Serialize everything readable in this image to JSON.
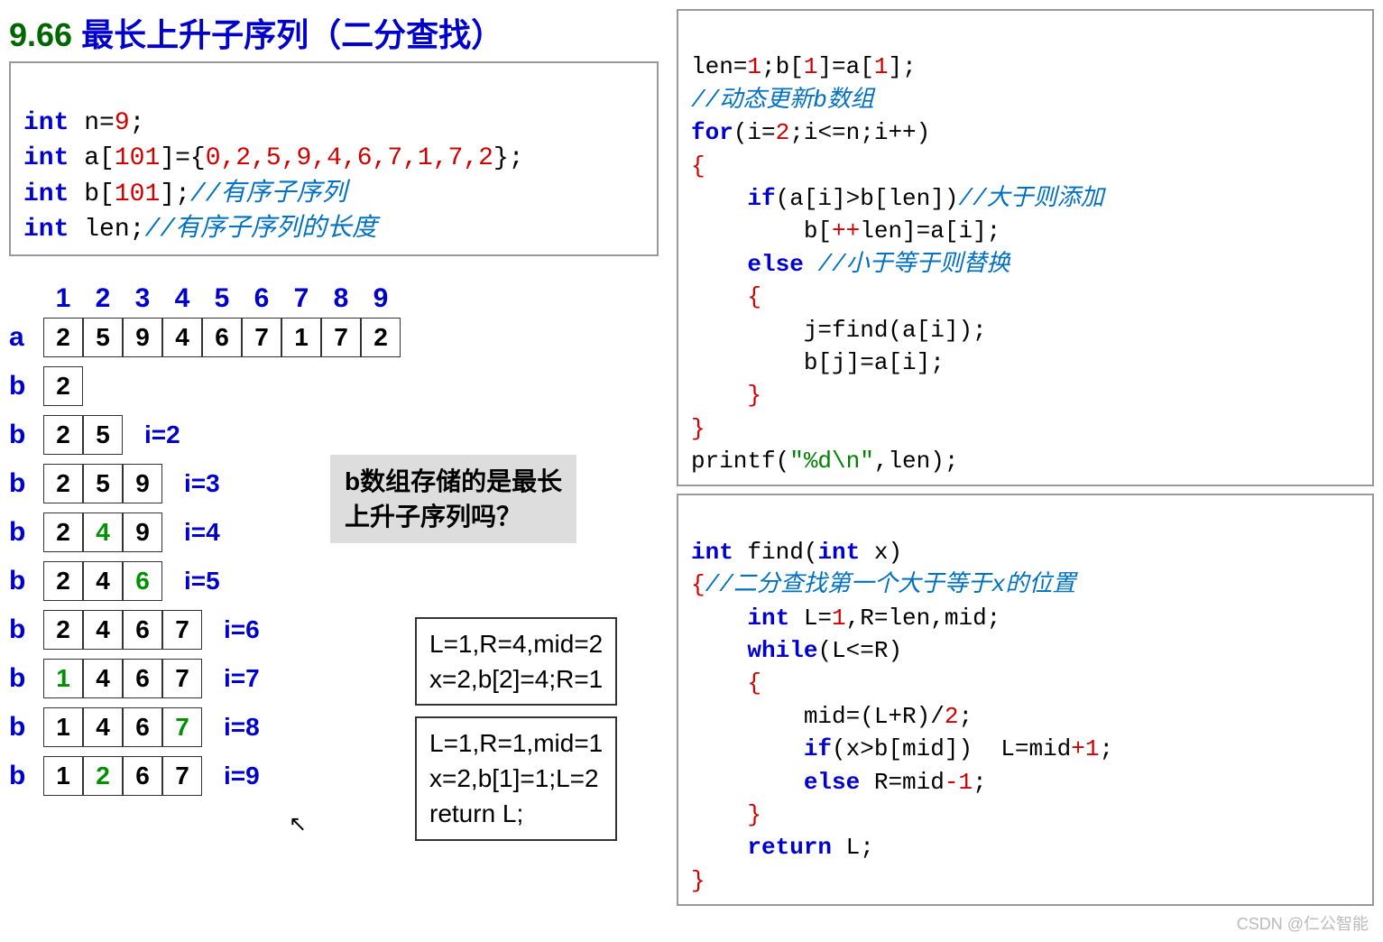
{
  "title": {
    "num": "9.66",
    "txt": " 最长上升子序列（二分查找）"
  },
  "decl": {
    "l1a": "int",
    "l1b": " n=",
    "l1c": "9",
    "l1d": ";",
    "l2a": "int",
    "l2b": " a[",
    "l2c": "101",
    "l2d": "]={",
    "l2e": "0,2,5,9,4,6,7,1,7,2",
    "l2f": "};",
    "l3a": "int",
    "l3b": " b[",
    "l3c": "101",
    "l3d": "];",
    "l3e": "//有序子序列",
    "l4a": "int",
    "l4b": " len;",
    "l4c": "//有序子序列的长度"
  },
  "idx": [
    "1",
    "2",
    "3",
    "4",
    "5",
    "6",
    "7",
    "8",
    "9"
  ],
  "rows": [
    {
      "lbl": "a",
      "cells": [
        {
          "v": "2"
        },
        {
          "v": "5"
        },
        {
          "v": "9"
        },
        {
          "v": "4"
        },
        {
          "v": "6"
        },
        {
          "v": "7"
        },
        {
          "v": "1"
        },
        {
          "v": "7"
        },
        {
          "v": "2"
        }
      ],
      "step": ""
    },
    {
      "lbl": "b",
      "cells": [
        {
          "v": "2"
        }
      ],
      "step": ""
    },
    {
      "lbl": "b",
      "cells": [
        {
          "v": "2"
        },
        {
          "v": "5"
        }
      ],
      "step": "i=2"
    },
    {
      "lbl": "b",
      "cells": [
        {
          "v": "2"
        },
        {
          "v": "5"
        },
        {
          "v": "9"
        }
      ],
      "step": "i=3"
    },
    {
      "lbl": "b",
      "cells": [
        {
          "v": "2"
        },
        {
          "v": "4",
          "g": true
        },
        {
          "v": "9"
        }
      ],
      "step": "i=4"
    },
    {
      "lbl": "b",
      "cells": [
        {
          "v": "2"
        },
        {
          "v": "4"
        },
        {
          "v": "6",
          "g": true
        }
      ],
      "step": "i=5"
    },
    {
      "lbl": "b",
      "cells": [
        {
          "v": "2"
        },
        {
          "v": "4"
        },
        {
          "v": "6"
        },
        {
          "v": "7"
        }
      ],
      "step": "i=6"
    },
    {
      "lbl": "b",
      "cells": [
        {
          "v": "1",
          "g": true
        },
        {
          "v": "4"
        },
        {
          "v": "6"
        },
        {
          "v": "7"
        }
      ],
      "step": "i=7"
    },
    {
      "lbl": "b",
      "cells": [
        {
          "v": "1"
        },
        {
          "v": "4"
        },
        {
          "v": "6"
        },
        {
          "v": "7",
          "g": true
        }
      ],
      "step": "i=8"
    },
    {
      "lbl": "b",
      "cells": [
        {
          "v": "1"
        },
        {
          "v": "2",
          "g": true
        },
        {
          "v": "6"
        },
        {
          "v": "7"
        }
      ],
      "step": "i=9"
    }
  ],
  "question": "b数组存储的是最长\n上升子序列吗？",
  "trace1": "L=1,R=4,mid=2\nx=2,b[2]=4;R=1",
  "trace2": "L=1,R=1,mid=1\nx=2,b[1]=1;L=2\nreturn L;",
  "code1": {
    "l1": {
      "a": "len=",
      "b": "1",
      "c": ";b[",
      "d": "1",
      "e": "]=a[",
      "f": "1",
      "g": "];"
    },
    "l2": "//动态更新b数组",
    "l3": {
      "a": "for",
      "b": "(i=",
      "c": "2",
      "d": ";i<=n;i++)"
    },
    "l4": "{",
    "l5": {
      "a": "    if",
      "b": "(a[i]>b[len])",
      "c": "//大于则添加"
    },
    "l6": {
      "a": "        b[",
      "b": "++",
      "c": "len]=a[i];"
    },
    "l7": {
      "a": "    else ",
      "b": "//小于等于则替换"
    },
    "l8": "    {",
    "l9": "        j=find(a[i]);",
    "l10": "        b[j]=a[i];",
    "l11": "    }",
    "l12": "}",
    "l13": {
      "a": "printf(",
      "b": "\"%d\\n\"",
      "c": ",len);"
    }
  },
  "code2": {
    "l1": {
      "a": "int",
      "b": " find(",
      "c": "int",
      "d": " x)"
    },
    "l2": {
      "a": "{",
      "b": "//二分查找第一个大于等于x的位置"
    },
    "l3": {
      "a": "    int",
      "b": " L=",
      "c": "1",
      "d": ",R=len,mid;"
    },
    "l4": {
      "a": "    while",
      "b": "(L<=R)"
    },
    "l5": "    {",
    "l6": {
      "a": "        mid=(L+R)/",
      "b": "2",
      "c": ";"
    },
    "l7": {
      "a": "        if",
      "b": "(x>b[mid])  L=mid",
      "c": "+1",
      "d": ";"
    },
    "l8": {
      "a": "        else",
      "b": " R=mid",
      "c": "-1",
      "d": ";"
    },
    "l9": "    }",
    "l10": {
      "a": "    return",
      "b": " L;"
    },
    "l11": "}"
  },
  "watermark": "CSDN @仁公智能"
}
